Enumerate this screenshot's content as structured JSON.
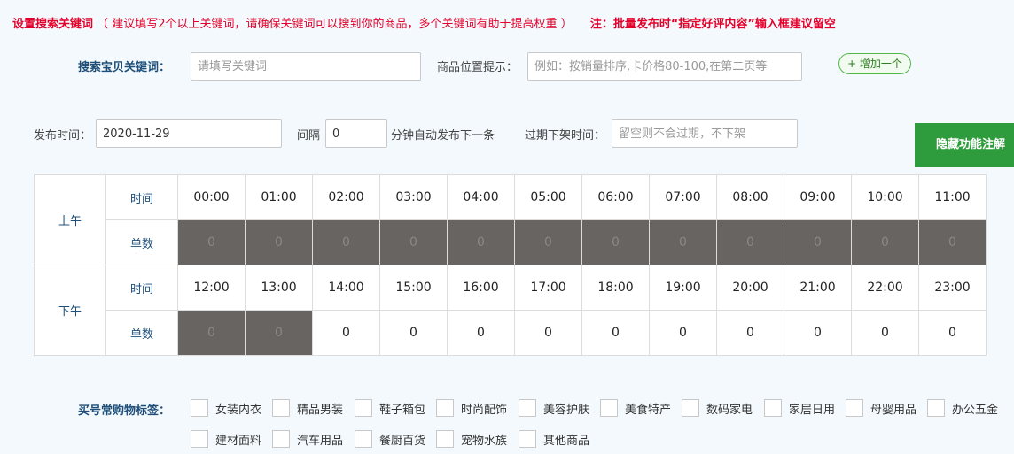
{
  "notice": {
    "title": "设置搜索关键词",
    "hint": "（ 建议填写2个以上关键词，请确保关键词可以搜到你的商品，多个关键词有助于提高权重 ）",
    "warning": "注：批量发布时“指定好评内容”输入框建议留空"
  },
  "search": {
    "keyword_label": "搜索宝贝关键词：",
    "keyword_placeholder": "请填写关键词",
    "position_label": "商品位置提示：",
    "position_placeholder": "例如：按销量排序,卡价格80-100,在第二页等",
    "add_button": "+ 增加一个"
  },
  "publish": {
    "time_label": "发布时间：",
    "time_value": "2020-11-29",
    "interval_label": "间隔",
    "interval_value": "0",
    "interval_suffix": "分钟自动发布下一条",
    "expire_label": "过期下架时间：",
    "expire_placeholder": "留空则不会过期，不下架",
    "hidden_button": "隐藏功能注解"
  },
  "schedule": {
    "time_label": "时间",
    "count_label": "单数",
    "morning": {
      "label": "上午",
      "times": [
        "00:00",
        "01:00",
        "02:00",
        "03:00",
        "04:00",
        "05:00",
        "06:00",
        "07:00",
        "08:00",
        "09:00",
        "10:00",
        "11:00"
      ],
      "counts": [
        "0",
        "0",
        "0",
        "0",
        "0",
        "0",
        "0",
        "0",
        "0",
        "0",
        "0",
        "0"
      ],
      "disabled": [
        true,
        true,
        true,
        true,
        true,
        true,
        true,
        true,
        true,
        true,
        true,
        true
      ]
    },
    "afternoon": {
      "label": "下午",
      "times": [
        "12:00",
        "13:00",
        "14:00",
        "15:00",
        "16:00",
        "17:00",
        "18:00",
        "19:00",
        "20:00",
        "21:00",
        "22:00",
        "23:00"
      ],
      "counts": [
        "0",
        "0",
        "0",
        "0",
        "0",
        "0",
        "0",
        "0",
        "0",
        "0",
        "0",
        "0"
      ],
      "disabled": [
        true,
        true,
        false,
        false,
        false,
        false,
        false,
        false,
        false,
        false,
        false,
        false
      ]
    }
  },
  "tags": {
    "label": "买号常购物标签：",
    "items": [
      "女装内衣",
      "精品男装",
      "鞋子箱包",
      "时尚配饰",
      "美容护肤",
      "美食特产",
      "数码家电",
      "家居日用",
      "母婴用品",
      "办公五金",
      "建材面料",
      "汽车用品",
      "餐厨百货",
      "宠物水族",
      "其他商品"
    ]
  },
  "colors": {
    "accent_green": "#2e9b3c",
    "notice_red": "#e4002b",
    "label_blue": "#1e4f7a",
    "disabled_cell": "#676462"
  }
}
